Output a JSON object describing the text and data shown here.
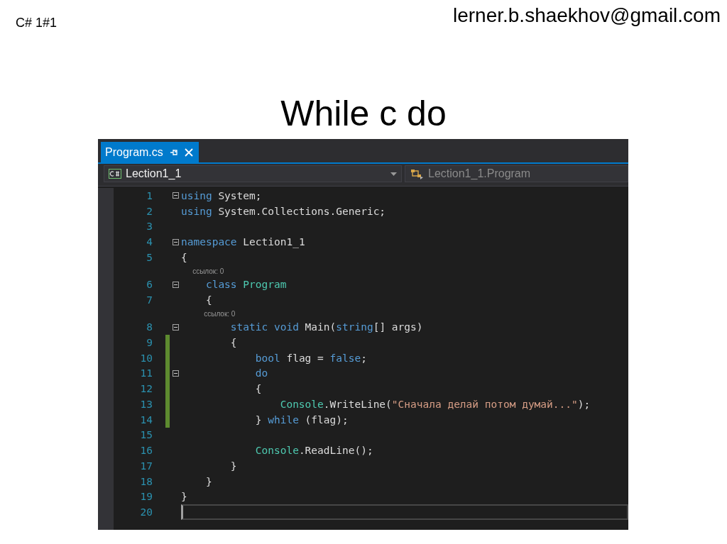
{
  "slide": {
    "course": "C# 1#1",
    "email": "lerner.b.shaekhov@gmail.com",
    "title": "While c do"
  },
  "editor": {
    "tabs": [
      {
        "label": "Program.cs",
        "selected": true
      }
    ],
    "navigation": {
      "project": "Lection1_1",
      "member": "Lection1_1.Program"
    },
    "lines": [
      {
        "kind": "code",
        "number": "1",
        "fold": true,
        "modified": false,
        "current": false,
        "tokens": [
          {
            "kind": "keyword",
            "text": "using"
          },
          {
            "kind": "plain",
            "text": " System;"
          }
        ]
      },
      {
        "kind": "code",
        "number": "2",
        "fold": false,
        "modified": false,
        "current": false,
        "tokens": [
          {
            "kind": "keyword",
            "text": "using"
          },
          {
            "kind": "plain",
            "text": " System.Collections.Generic;"
          }
        ]
      },
      {
        "kind": "code",
        "number": "3",
        "fold": false,
        "modified": false,
        "current": false
      },
      {
        "kind": "code",
        "number": "4",
        "fold": true,
        "modified": false,
        "current": false,
        "tokens": [
          {
            "kind": "keyword",
            "text": "namespace"
          },
          {
            "kind": "plain",
            "text": " Lection1_1"
          }
        ]
      },
      {
        "kind": "code",
        "number": "5",
        "fold": false,
        "modified": false,
        "current": false,
        "tokens": [
          {
            "kind": "plain",
            "text": "{"
          }
        ]
      },
      {
        "kind": "codelens",
        "text": "ссылок: 0"
      },
      {
        "kind": "code",
        "number": "6",
        "fold": true,
        "modified": false,
        "current": false,
        "tokens": [
          {
            "kind": "keyword",
            "text": "    class"
          },
          {
            "kind": "type",
            "text": " Program"
          }
        ]
      },
      {
        "kind": "code",
        "number": "7",
        "fold": false,
        "modified": false,
        "current": false,
        "tokens": [
          {
            "kind": "plain",
            "text": "    {"
          }
        ]
      },
      {
        "kind": "codelens",
        "text": "ссылок: 0"
      },
      {
        "kind": "code",
        "number": "8",
        "fold": true,
        "modified": false,
        "current": false,
        "tokens": [
          {
            "kind": "keyword",
            "text": "        static"
          },
          {
            "kind": "keyword",
            "text": " void"
          },
          {
            "kind": "plain",
            "text": " Main("
          },
          {
            "kind": "keyword",
            "text": "string"
          },
          {
            "kind": "plain",
            "text": "[] args)"
          }
        ]
      },
      {
        "kind": "code",
        "number": "9",
        "fold": false,
        "modified": true,
        "current": false,
        "tokens": [
          {
            "kind": "plain",
            "text": "        {"
          }
        ]
      },
      {
        "kind": "code",
        "number": "10",
        "fold": false,
        "modified": true,
        "current": false,
        "tokens": [
          {
            "kind": "keyword",
            "text": "            bool"
          },
          {
            "kind": "plain",
            "text": " flag = "
          },
          {
            "kind": "keyword",
            "text": "false"
          },
          {
            "kind": "plain",
            "text": ";"
          }
        ]
      },
      {
        "kind": "code",
        "number": "11",
        "fold": true,
        "modified": true,
        "current": false,
        "tokens": [
          {
            "kind": "keyword",
            "text": "            do"
          }
        ]
      },
      {
        "kind": "code",
        "number": "12",
        "fold": false,
        "modified": true,
        "current": false,
        "tokens": [
          {
            "kind": "plain",
            "text": "            {"
          }
        ]
      },
      {
        "kind": "code",
        "number": "13",
        "fold": false,
        "modified": true,
        "current": false,
        "tokens": [
          {
            "kind": "type",
            "text": "                Console"
          },
          {
            "kind": "plain",
            "text": ".WriteLine("
          },
          {
            "kind": "string",
            "text": "\"Сначала делай потом думай...\""
          },
          {
            "kind": "plain",
            "text": ");"
          }
        ]
      },
      {
        "kind": "code",
        "number": "14",
        "fold": false,
        "modified": true,
        "current": false,
        "tokens": [
          {
            "kind": "plain",
            "text": "            } "
          },
          {
            "kind": "keyword",
            "text": "while"
          },
          {
            "kind": "plain",
            "text": " (flag);"
          }
        ]
      },
      {
        "kind": "code",
        "number": "15",
        "fold": false,
        "modified": false,
        "current": false
      },
      {
        "kind": "code",
        "number": "16",
        "fold": false,
        "modified": false,
        "current": false,
        "tokens": [
          {
            "kind": "type",
            "text": "            Console"
          },
          {
            "kind": "plain",
            "text": ".ReadLine();"
          }
        ]
      },
      {
        "kind": "code",
        "number": "17",
        "fold": false,
        "modified": false,
        "current": false,
        "tokens": [
          {
            "kind": "plain",
            "text": "        }"
          }
        ]
      },
      {
        "kind": "code",
        "number": "18",
        "fold": false,
        "modified": false,
        "current": false,
        "tokens": [
          {
            "kind": "plain",
            "text": "    }"
          }
        ]
      },
      {
        "kind": "code",
        "number": "19",
        "fold": false,
        "modified": false,
        "current": false,
        "tokens": [
          {
            "kind": "plain",
            "text": "}"
          }
        ]
      },
      {
        "kind": "code",
        "number": "20",
        "fold": false,
        "modified": false,
        "current": true
      }
    ]
  }
}
